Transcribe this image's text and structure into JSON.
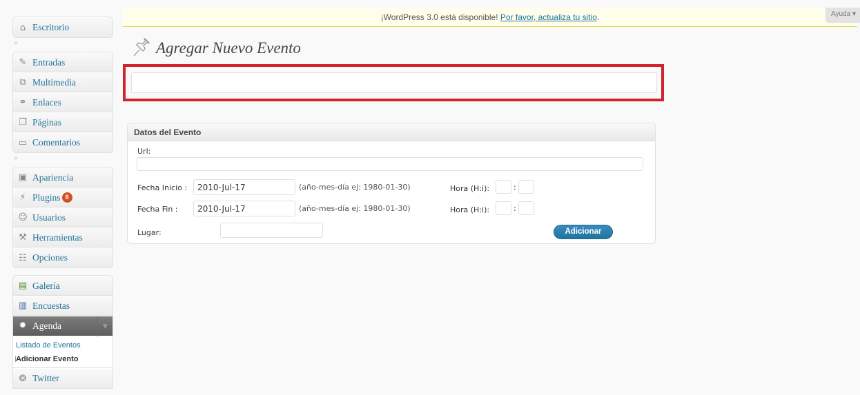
{
  "sidebar": {
    "group1": [
      {
        "label": "Escritorio",
        "icon": "house-icon"
      }
    ],
    "group2": [
      {
        "label": "Entradas",
        "icon": "pin-icon"
      },
      {
        "label": "Multimedia",
        "icon": "media-icon"
      },
      {
        "label": "Enlaces",
        "icon": "link-icon"
      },
      {
        "label": "Páginas",
        "icon": "pages-icon"
      },
      {
        "label": "Comentarios",
        "icon": "comment-icon"
      }
    ],
    "group3": [
      {
        "label": "Apariencia",
        "icon": "appearance-icon"
      },
      {
        "label": "Plugins",
        "icon": "plugin-icon",
        "badge": "8"
      },
      {
        "label": "Usuarios",
        "icon": "users-icon"
      },
      {
        "label": "Herramientas",
        "icon": "tools-icon"
      },
      {
        "label": "Opciones",
        "icon": "settings-icon"
      }
    ],
    "group4": [
      {
        "label": "Galería",
        "icon": "gallery-icon"
      },
      {
        "label": "Encuestas",
        "icon": "poll-icon"
      },
      {
        "label": "Agenda",
        "icon": "agenda-icon"
      }
    ],
    "agenda_submenu": [
      {
        "label": "Listado de Eventos"
      },
      {
        "label": "Adicionar Evento"
      }
    ],
    "group5": [
      {
        "label": "Twitter",
        "icon": "twitter-icon"
      }
    ]
  },
  "update_nag": {
    "text": "¡WordPress 3.0 está disponible! ",
    "link": "Por favor, actualiza tu sitio",
    "suffix": "."
  },
  "help_tab": "Ayuda ▾",
  "page": {
    "title": "Agregar Nuevo Evento",
    "title_input_value": ""
  },
  "metabox": {
    "title": "Datos del Evento",
    "url_label": "Url:",
    "url_value": "",
    "start_label": "Fecha Inicio :",
    "start_value": "2010-Jul-17",
    "start_hint": "(año-mes-día ej: 1980-01-30)",
    "start_time_label": "Hora (H:i):",
    "start_hour": "",
    "start_minute": "",
    "end_label": "Fecha Fin :",
    "end_value": "2010-Jul-17",
    "end_hint": "(año-mes-día ej: 1980-01-30)",
    "end_time_label": "Hora (H:i):",
    "end_hour": "",
    "end_minute": "",
    "time_separator": ":",
    "place_label": "Lugar:",
    "place_value": "",
    "submit_label": "Adicionar"
  },
  "colors": {
    "link": "#21759b",
    "highlight": "#d0252b",
    "badge": "#d54e21",
    "active_menu": "#6d6d6d"
  }
}
